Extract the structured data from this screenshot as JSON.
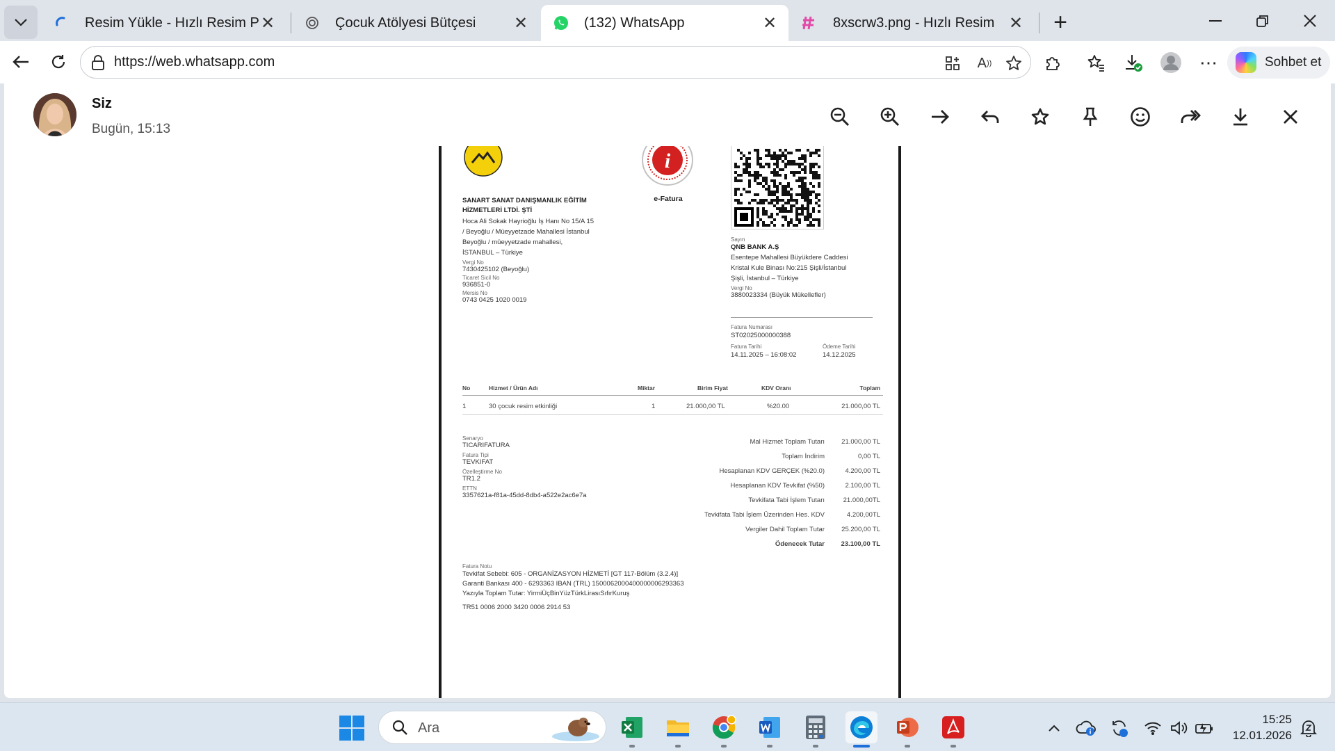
{
  "browser": {
    "tabs": [
      {
        "label": "Resim Yükle - Hızlı Resim Paylaş - H",
        "favicon": "loading-spinner-icon",
        "active": false
      },
      {
        "label": "Çocuk Atölyesi Bütçesi",
        "favicon": "chatgpt-icon",
        "active": false
      },
      {
        "label": "(132) WhatsApp",
        "favicon": "whatsapp-icon",
        "active": true
      },
      {
        "label": "8xscrw3.png - Hızlı Resim",
        "favicon": "hizli-resim-icon",
        "active": false
      }
    ],
    "url": "https://web.whatsapp.com",
    "copilot_label": "Sohbet et"
  },
  "viewer": {
    "sender_name": "Siz",
    "sender_time": "Bugün, 15:13",
    "actions": [
      "zoom-out",
      "zoom-in",
      "forward-arrow",
      "reply",
      "star",
      "pin",
      "react",
      "share",
      "download",
      "close"
    ]
  },
  "invoice": {
    "logo_caption": "e-Fatura",
    "seller": {
      "name_line1": "SANART SANAT DANIŞMANLIK EĞİTİM",
      "name_line2": "HİZMETLERİ LTDİ. ŞTİ",
      "address": [
        "Hoca Ali Sokak Hayrioğlu İş Hanı No 15/A 15",
        "/ Beyoğlu / Müeyyetzade Mahallesi İstanbul",
        "Beyoğlu / müeyyetzade mahallesi,",
        "İSTANBUL – Türkiye"
      ],
      "tax_label": "Vergi No",
      "tax_value": "7430425102 (Beyoğlu)",
      "trade_label": "Ticaret Sicil No",
      "trade_value": "936851-0",
      "mersis_label": "Mersis No",
      "mersis_value": "0743 0425 1020 0019"
    },
    "buyer": {
      "label": "Sayın",
      "name": "QNB BANK A.Ş",
      "address": [
        "Esentepe Mahallesi Büyükdere Caddesi",
        "Kristal Kule Binası No:215 Şişli/İstanbul",
        "Şişli, İstanbul – Türkiye"
      ],
      "tax_label": "Vergi No",
      "tax_value": "3880023334 (Büyük Mükellefler)"
    },
    "meta": {
      "number_label": "Fatura Numarası",
      "number_value": "ST02025000000388",
      "date_label": "Fatura Tarihi",
      "date_value": "14.11.2025 – 16:08:02",
      "due_label": "Ödeme Tarihi",
      "due_value": "14.12.2025"
    },
    "table": {
      "headers": {
        "no": "No",
        "name": "Hizmet / Ürün Adı",
        "qty": "Miktar",
        "price": "Birim Fiyat",
        "vat": "KDV Oranı",
        "total": "Toplam"
      },
      "row": {
        "no": "1",
        "name": "30 çocuk resim etkinliği",
        "qty": "1",
        "price": "21.000,00 TL",
        "vat": "%20.00",
        "total": "21.000,00 TL"
      }
    },
    "info": {
      "scenario_label": "Senaryo",
      "scenario_value": "TICARIFATURA",
      "type_label": "Fatura Tipi",
      "type_value": "TEVKIFAT",
      "custom_label": "Özelleştirme No",
      "custom_value": "TR1.2",
      "ettn_label": "ETTN",
      "ettn_value": "3357621a-f81a-45dd-8db4-a522e2ac6e7a"
    },
    "summary": [
      {
        "label": "Mal Hizmet Toplam Tutarı",
        "value": "21.000,00 TL"
      },
      {
        "label": "Toplam İndirim",
        "value": "0,00 TL"
      },
      {
        "label": "Hesaplanan KDV GERÇEK (%20.0)",
        "value": "4.200,00 TL"
      },
      {
        "label": "Hesaplanan KDV Tevkifat (%50)",
        "value": "2.100,00 TL"
      },
      {
        "label": "Tevkifata Tabi İşlem Tutarı",
        "value": "21.000,00TL"
      },
      {
        "label": "Tevkifata Tabi İşlem Üzerinden Hes. KDV",
        "value": "4.200,00TL"
      },
      {
        "label": "Vergiler Dahil Toplam Tutar",
        "value": "25.200,00 TL"
      },
      {
        "label": "Ödenecek Tutar",
        "value": "23.100,00 TL"
      }
    ],
    "notes": {
      "label": "Fatura Notu",
      "line1": "Tevkifat Sebebi: 605 - ORGANİZASYON HİZMETİ [GT 117-Bölüm (3.2.4)]",
      "line2": "Garanti Bankası 400 - 6293363 IBAN (TRL) 1500062000400000006293363",
      "line3": "Yazıyla Toplam Tutar: YirmiÜçBinYüzTürkLirasıSıfırKuruş",
      "line4": "TR51 0006 2000 3420 0006 2914 53"
    }
  },
  "taskbar": {
    "search_placeholder": "Ara",
    "time": "15:25",
    "date": "12.01.2026"
  },
  "colors": {
    "whatsapp_green": "#25d366",
    "taskbar_bg": "#dbe6f1",
    "accent_blue": "#1e6fd9"
  }
}
